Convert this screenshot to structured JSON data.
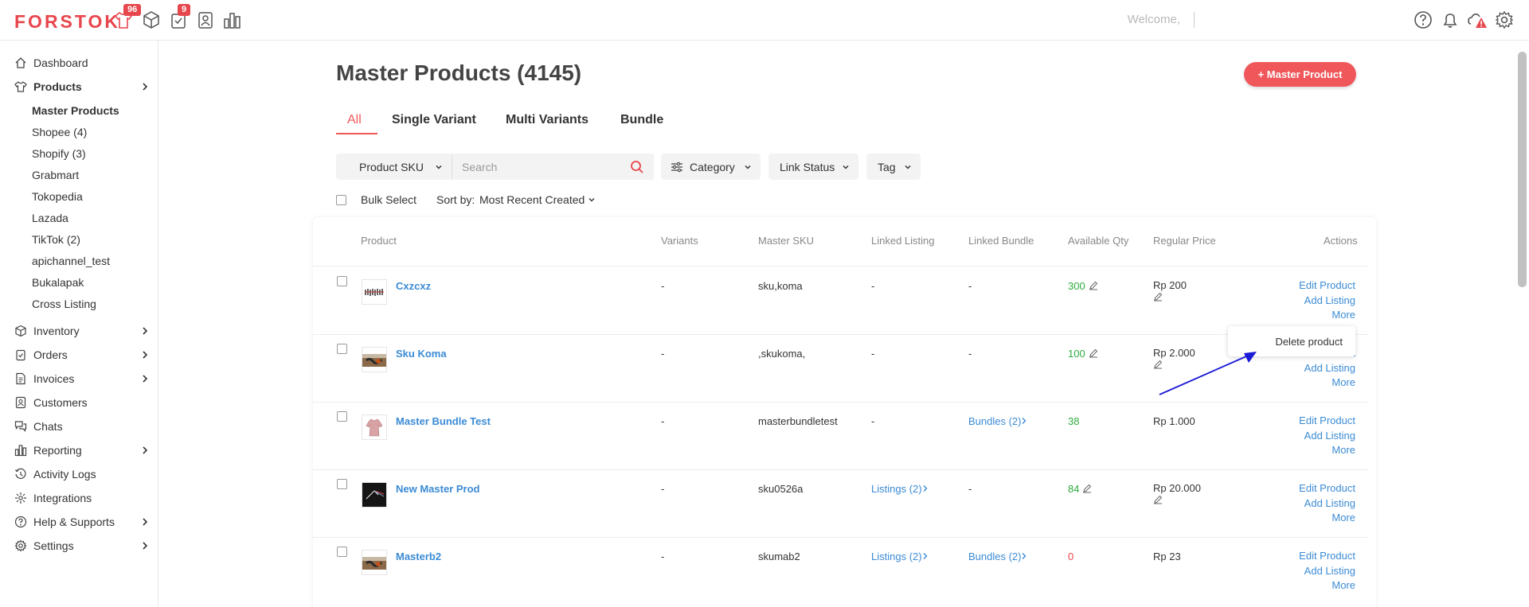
{
  "brand": {
    "logo": "FORSTOK",
    "accent": "#e8464d"
  },
  "header": {
    "badge_products": "96",
    "badge_orders": "9",
    "welcome": "Welcome,"
  },
  "sidebar": {
    "dashboard": "Dashboard",
    "products": "Products",
    "product_subs": [
      "Master Products",
      "Shopee (4)",
      "Shopify (3)",
      "Grabmart",
      "Tokopedia",
      "Lazada",
      "TikTok (2)",
      "apichannel_test",
      "Bukalapak",
      "Cross Listing"
    ],
    "inventory": "Inventory",
    "orders": "Orders",
    "invoices": "Invoices",
    "customers": "Customers",
    "chats": "Chats",
    "reporting": "Reporting",
    "activity_logs": "Activity Logs",
    "integrations": "Integrations",
    "help": "Help & Supports",
    "settings": "Settings"
  },
  "main": {
    "title": "Master Products (4145)",
    "add_button": "+ Master Product",
    "tabs": [
      "All",
      "Single Variant",
      "Multi Variants",
      "Bundle"
    ],
    "filter_field": "Product SKU",
    "search_placeholder": "Search",
    "category": "Category",
    "link_status": "Link Status",
    "tag": "Tag",
    "bulk_select": "Bulk Select",
    "sort_label": "Sort by:",
    "sort_value": "Most Recent Created",
    "columns": [
      "Product",
      "Variants",
      "Master SKU",
      "Linked Listing",
      "Linked Bundle",
      "Available Qty",
      "Regular Price",
      "Actions"
    ],
    "rows": [
      {
        "name": "Cxzcxz",
        "variants": "-",
        "sku": "sku,koma",
        "listing": "-",
        "bundle": "-",
        "qty": "300",
        "price": "Rp 200"
      },
      {
        "name": "Sku Koma",
        "variants": "-",
        "sku": ",skukoma,",
        "listing": "-",
        "bundle": "-",
        "qty": "100",
        "price": "Rp 2.000"
      },
      {
        "name": "Master Bundle Test",
        "variants": "-",
        "sku": "masterbundletest",
        "listing": "-",
        "bundle": "Bundles (2)",
        "qty": "38",
        "price": "Rp 1.000"
      },
      {
        "name": "New Master Prod",
        "variants": "-",
        "sku": "sku0526a",
        "listing": "Listings (2)",
        "bundle": "-",
        "qty": "84",
        "price": "Rp 20.000"
      },
      {
        "name": "Masterb2",
        "variants": "-",
        "sku": "skumab2",
        "listing": "Listings (2)",
        "bundle": "Bundles (2)",
        "qty": "0",
        "price": "Rp 23"
      }
    ],
    "actions": {
      "edit": "Edit Product",
      "add": "Add Listing",
      "more": "More"
    },
    "popup": "Delete product"
  }
}
